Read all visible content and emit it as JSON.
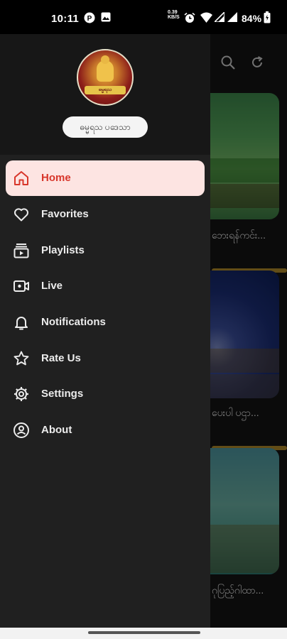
{
  "status_bar": {
    "time": "10:11",
    "network_speed_value": "0.39",
    "network_speed_unit": "KB/S",
    "battery": "84%"
  },
  "drawer": {
    "logo_text": "ဓမ္မရသ",
    "profile_name": "ဓမ္မရသ ပဒေသာ",
    "items": [
      {
        "label": "Home",
        "icon": "home-icon"
      },
      {
        "label": "Favorites",
        "icon": "heart-icon"
      },
      {
        "label": "Playlists",
        "icon": "playlist-icon"
      },
      {
        "label": "Live",
        "icon": "video-camera-icon"
      },
      {
        "label": "Notifications",
        "icon": "bell-icon"
      },
      {
        "label": "Rate Us",
        "icon": "star-icon"
      },
      {
        "label": "Settings",
        "icon": "gear-icon"
      },
      {
        "label": "About",
        "icon": "account-icon"
      }
    ],
    "active_index": 0
  },
  "background": {
    "actions": [
      "search-icon",
      "refresh-icon"
    ],
    "cards": [
      {
        "title": "ဘေးရန်ကင်း..."
      },
      {
        "title": "ပေးပါ ပဌာ..."
      },
      {
        "title": "ဂုပြည့်ဂါထာ..."
      }
    ]
  },
  "colors": {
    "accent": "#d8362b",
    "active_bg": "#fde4e2",
    "drawer_bg": "#202020",
    "header_bg": "#171717"
  }
}
